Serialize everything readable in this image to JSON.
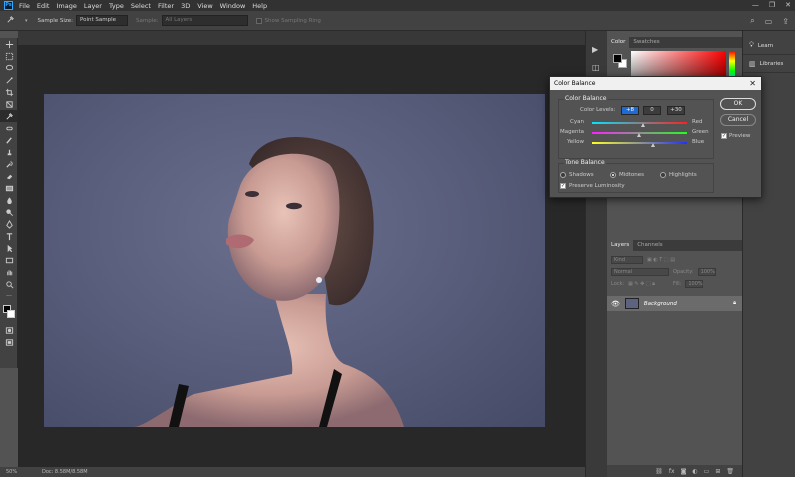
{
  "menu": {
    "logo": "Ps",
    "items": [
      "File",
      "Edit",
      "Image",
      "Layer",
      "Type",
      "Select",
      "Filter",
      "3D",
      "View",
      "Window",
      "Help"
    ]
  },
  "window_controls": [
    "—",
    "❐",
    "✕"
  ],
  "options_bar": {
    "sample_size_label": "Sample Size:",
    "sample_size_value": "Point Sample",
    "sample_label": "Sample:",
    "sample_value": "All Layers",
    "show_sampling_ring": "Show Sampling Ring"
  },
  "status": {
    "zoom": "50%",
    "doc": "Doc: 8.58M/8.58M"
  },
  "color_panel": {
    "tabs": [
      "Color",
      "Swatches"
    ],
    "fg_color": "#000000",
    "bg_color": "#ffffff"
  },
  "learn_panel": {
    "items": [
      "Learn",
      "Libraries"
    ]
  },
  "layers_panel": {
    "tabs": [
      "Layers",
      "Channels"
    ],
    "kind_placeholder": "Kind",
    "blend_mode": "Normal",
    "opacity_label": "Opacity:",
    "opacity_value": "100%",
    "lock_label": "Lock:",
    "fill_label": "Fill:",
    "fill_value": "100%",
    "layers": [
      {
        "name": "Background",
        "visible": true,
        "locked": true
      }
    ],
    "footer_icons": [
      "link-icon",
      "fx-icon",
      "mask-icon",
      "adjustment-icon",
      "group-icon",
      "new-layer-icon",
      "trash-icon"
    ]
  },
  "dialog": {
    "title": "Color Balance",
    "color_balance_group": "Color Balance",
    "color_levels_label": "Color Levels:",
    "levels": [
      "+8",
      "0",
      "+30"
    ],
    "sliders": [
      {
        "left": "Cyan",
        "right": "Red",
        "value": 8,
        "gradient": [
          "#00e5ff",
          "#ff2020"
        ]
      },
      {
        "left": "Magenta",
        "right": "Green",
        "value": 0,
        "gradient": [
          "#ff20ff",
          "#20ff20"
        ]
      },
      {
        "left": "Yellow",
        "right": "Blue",
        "value": 30,
        "gradient": [
          "#ffff20",
          "#2030ff"
        ]
      }
    ],
    "tone_balance_group": "Tone Balance",
    "tones": [
      {
        "label": "Shadows",
        "selected": false
      },
      {
        "label": "Midtones",
        "selected": true
      },
      {
        "label": "Highlights",
        "selected": false
      }
    ],
    "preserve_luminosity": "Preserve Luminosity",
    "preserve_checked": true,
    "ok_label": "OK",
    "cancel_label": "Cancel",
    "preview_label": "Preview",
    "preview_checked": true
  }
}
